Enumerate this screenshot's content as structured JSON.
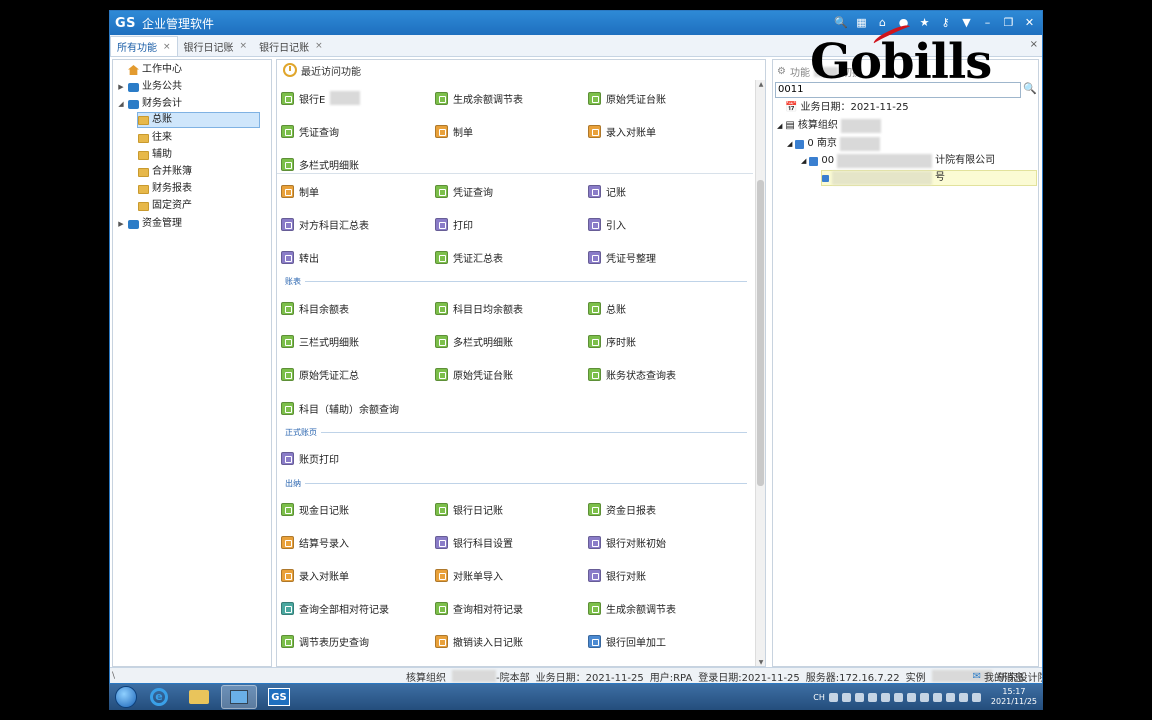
{
  "titlebar": {
    "logo": "GS",
    "title": "企业管理软件"
  },
  "tabs": [
    {
      "label": "所有功能",
      "close": "×"
    },
    {
      "label": "银行日记账",
      "close": "×"
    },
    {
      "label": "银行日记账",
      "close": "×"
    }
  ],
  "tabbar_close": "×",
  "left_tree": [
    {
      "label": "工作中心",
      "icon": "home-icon"
    },
    {
      "label": "业务公共",
      "icon": "module-icon"
    },
    {
      "label": "财务会计",
      "icon": "module-icon"
    },
    {
      "label": "总账",
      "icon": "folder-icon"
    },
    {
      "label": "往来",
      "icon": "folder-icon"
    },
    {
      "label": "辅助",
      "icon": "folder-icon"
    },
    {
      "label": "合并账簿",
      "icon": "folder-icon"
    },
    {
      "label": "财务报表",
      "icon": "folder-icon"
    },
    {
      "label": "固定资产",
      "icon": "folder-icon"
    },
    {
      "label": "资金管理",
      "icon": "module-icon"
    }
  ],
  "middle": {
    "header": "最近访问功能",
    "recent": [
      "银行E",
      "生成余额调节表",
      "原始凭证台账",
      "凭证查询",
      "制单",
      "录入对账单",
      "多栏式明细账"
    ],
    "group1": [
      "制单",
      "凭证查询",
      "记账",
      "对方科目汇总表",
      "打印",
      "引入",
      "转出",
      "凭证汇总表",
      "凭证号整理"
    ],
    "section_ledger": "账表",
    "ledger": [
      "科目余额表",
      "科目日均余额表",
      "总账",
      "三栏式明细账",
      "多栏式明细账",
      "序时账",
      "原始凭证汇总",
      "原始凭证台账",
      "账务状态查询表",
      "科目（辅助）余额查询"
    ],
    "section_formal": "正式账页",
    "formal": [
      "账页打印"
    ],
    "section_cashier": "出纳",
    "cashier": [
      "现金日记账",
      "银行日记账",
      "资金日报表",
      "结算号录入",
      "银行科目设置",
      "银行对账初始",
      "录入对账单",
      "对账单导入",
      "银行对账",
      "查询全部相对符记录",
      "查询相对符记录",
      "生成余额调节表",
      "调节表历史查询",
      "撤销读入日记账",
      "银行回单加工"
    ]
  },
  "right": {
    "title": "功能",
    "title_tail": "切换",
    "search_value": "0011",
    "nodes": [
      "业务日期：2021-11-25",
      "核算组织",
      "0 南京",
      "00",
      "计院有限公司",
      "号"
    ]
  },
  "watermark": "Gobills",
  "status": {
    "left": "\\",
    "org_label": "核算组织",
    "org_suffix": "-院本部",
    "biz_date": "业务日期：2021-11-25",
    "user": "用户:RPA",
    "login_date": "登录日期:2021-11-25",
    "server": "服务器:172.16.7.22",
    "instance": "实例",
    "inst_suffix": "研究设计院",
    "messages": "我的消息"
  },
  "taskbar": {
    "gs_label": "GS",
    "tray_text": "CH",
    "time": "15:17",
    "date": "2021/11/25"
  }
}
